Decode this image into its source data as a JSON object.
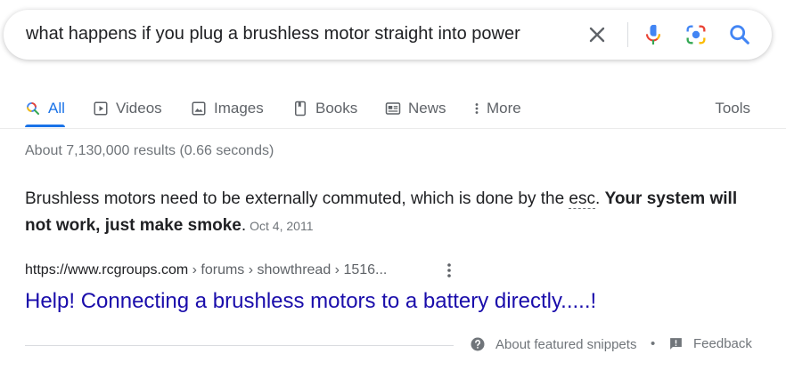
{
  "search": {
    "query": "what happens if you plug a brushless motor straight into power"
  },
  "tabs": [
    {
      "label": "All",
      "icon": "search-icon",
      "active": true
    },
    {
      "label": "Videos",
      "icon": "play-icon"
    },
    {
      "label": "Images",
      "icon": "image-icon"
    },
    {
      "label": "Books",
      "icon": "book-icon"
    },
    {
      "label": "News",
      "icon": "news-icon"
    },
    {
      "label": "More",
      "icon": "more-vert-icon"
    }
  ],
  "tools_label": "Tools",
  "stats": "About 7,130,000 results (0.66 seconds)",
  "snippet": {
    "text_before": "Brushless motors need to be externally commuted, which is done by the ",
    "term": "esc",
    "text_after": ". ",
    "bold": "Your system will not work, just make smoke",
    "period": ".",
    "date": "Oct 4, 2011"
  },
  "result": {
    "domain": "https://www.rcgroups.com",
    "path": " › forums › showthread › 1516...",
    "title": "Help! Connecting a brushless motors to a battery directly.....!"
  },
  "footer": {
    "about_label": "About featured snippets",
    "bullet": "•",
    "feedback_label": "Feedback"
  },
  "colors": {
    "accent": "#1a73e8",
    "link": "#1a0dab",
    "muted": "#70757a"
  }
}
